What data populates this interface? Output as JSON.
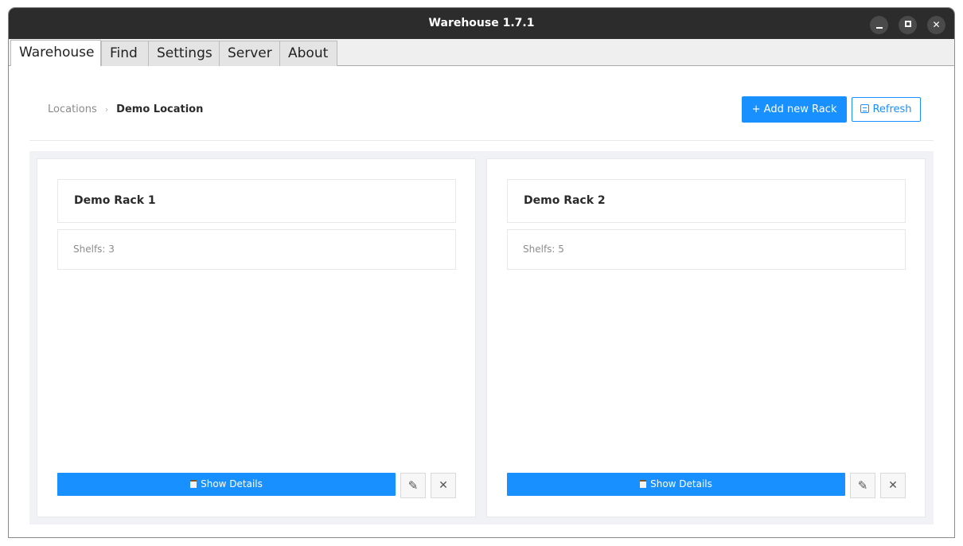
{
  "window": {
    "title": "Warehouse 1.7.1",
    "minimize_glyph": "",
    "close_glyph": "✕"
  },
  "tabs": [
    {
      "label": "Warehouse",
      "active": true
    },
    {
      "label": "Find",
      "active": false
    },
    {
      "label": "Settings",
      "active": false
    },
    {
      "label": "Server",
      "active": false
    },
    {
      "label": "About",
      "active": false
    }
  ],
  "breadcrumb": {
    "root": "Locations",
    "separator": "›",
    "current": "Demo Location"
  },
  "toolbar": {
    "add_label": "+ Add new Rack",
    "refresh_label": "Refresh"
  },
  "racks": [
    {
      "name": "Demo Rack 1",
      "shelfs_text": "Shelfs: 3",
      "details_label": "Show Details",
      "edit_glyph": "✎",
      "delete_glyph": "✕"
    },
    {
      "name": "Demo Rack 2",
      "shelfs_text": "Shelfs: 5",
      "details_label": "Show Details",
      "edit_glyph": "✎",
      "delete_glyph": "✕"
    }
  ],
  "colors": {
    "accent": "#1890ff",
    "titlebar": "#2c2c2c",
    "panel_background": "#f0f2f5"
  }
}
